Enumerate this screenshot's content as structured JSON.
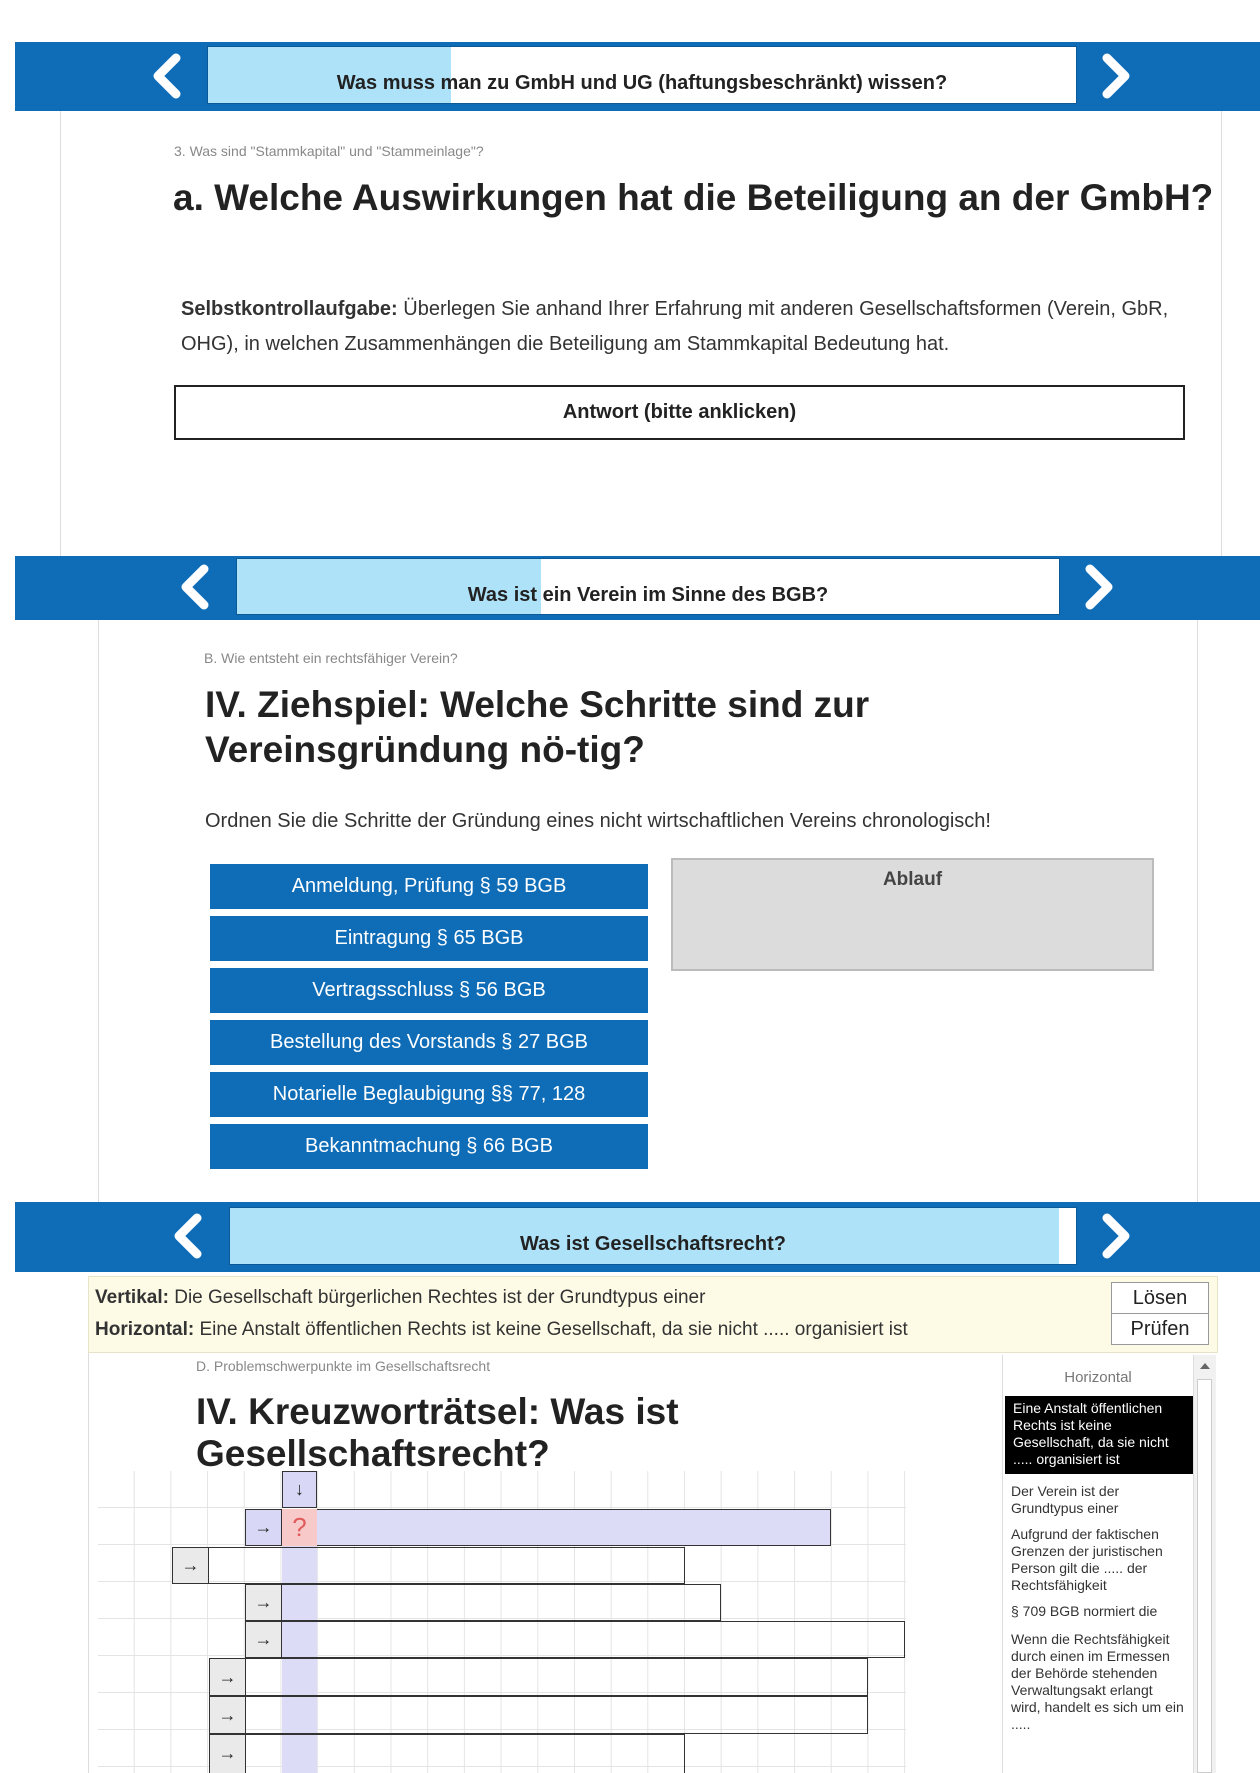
{
  "section1": {
    "header_title": "Was muss man zu GmbH und UG (haftungsbeschränkt) wissen?",
    "progress": 0.28,
    "breadcrumb": "3. Was sind \"Stammkapital\" und \"Stammeinlage\"?",
    "heading": "a. Welche Auswirkungen hat die Beteiligung an der GmbH?",
    "task_label": "Selbstkontrollaufgabe:",
    "task_text": "Überlegen Sie anhand Ihrer Erfahrung mit anderen Gesellschaftsformen (Verein, GbR, OHG), in welchen Zusammenhängen die Beteiligung am Stammkapital Bedeutung hat.",
    "answer_button": "Antwort (bitte anklicken)"
  },
  "section2": {
    "header_title": "Was ist ein Verein im Sinne des BGB?",
    "progress": 0.37,
    "breadcrumb": "B. Wie entsteht ein rechtsfähiger Verein?",
    "heading": "IV. Ziehspiel: Welche Schritte sind zur Vereinsgründung nö-tig?",
    "instruction": "Ordnen Sie die Schritte der Gründung eines nicht wirtschaftlichen Vereins chronologisch!",
    "items": [
      "Anmeldung, Prüfung § 59 BGB",
      "Eintragung § 65 BGB",
      "Vertragsschluss § 56 BGB",
      "Bestellung des Vorstands § 27 BGB",
      "Notarielle Beglaubigung §§ 77, 128",
      "Bekanntmachung § 66 BGB"
    ],
    "target_label": "Ablauf"
  },
  "section3": {
    "header_title": "Was ist Gesellschaftsrecht?",
    "progress": 0.98,
    "clue_vertical_label": "Vertikal:",
    "clue_vertical_text": "Die Gesellschaft bürgerlichen Rechtes ist der Grundtypus einer",
    "clue_horizontal_label": "Horizontal:",
    "clue_horizontal_text": "Eine Anstalt öffentlichen Rechts ist keine Gesellschaft, da sie nicht ..... organisiert ist",
    "solve_button": "Lösen",
    "check_button": "Prüfen",
    "breadcrumb": "D. Problemschwerpunkte im Gesellschaftsrecht",
    "heading": "IV. Kreuzworträtsel: Was ist Gesellschaftsrecht?",
    "clue_list_header": "Horizontal",
    "clue_list": [
      "Eine Anstalt öffentlichen Rechts ist keine Gesellschaft, da sie nicht ..... organisiert ist",
      "Der Verein ist der Grundtypus einer",
      "Aufgrund der faktischen Grenzen der juristischen Person gilt die ..... der Rechtsfähigkeit",
      "§ 709 BGB normiert die",
      "Wenn die Rechtsfähigkeit durch einen im Ermessen der Behörde stehenden Verwaltungsakt erlangt wird, handelt es sich um ein ....."
    ],
    "grid_down_arrow": "↓",
    "grid_right_arrow": "→",
    "grid_question": "?"
  },
  "icons": {
    "prev": "chevron-left-icon",
    "next": "chevron-right-icon"
  },
  "colors": {
    "header_blue": "#0f6db8",
    "progress_blue": "#aee2f8",
    "clue_bg": "#fdfbe6",
    "active_clue_bg": "#000000",
    "cell_highlight": "#dcdcf6",
    "question_bg": "#f8c9c9"
  }
}
